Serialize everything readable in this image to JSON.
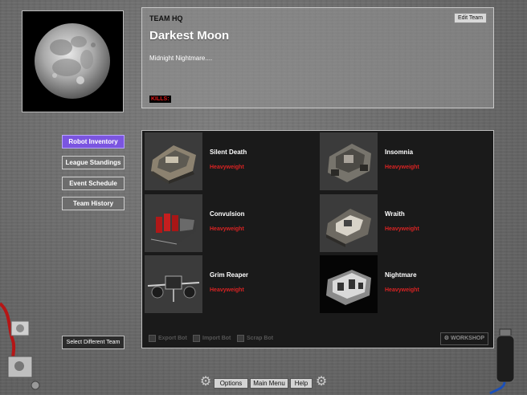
{
  "team": {
    "section_label": "TEAM HQ",
    "name": "Darkest Moon",
    "motto": "Midnight Nightmare....",
    "kills_label": "KILLS:",
    "edit_label": "Edit Team"
  },
  "nav": {
    "robot_inventory": "Robot Inventory",
    "league_standings": "League Standings",
    "event_schedule": "Event Schedule",
    "team_history": "Team History",
    "select_team": "Select Different Team"
  },
  "robots": [
    {
      "name": "Silent Death",
      "class": "Heavyweight"
    },
    {
      "name": "Insomnia",
      "class": "Heavyweight"
    },
    {
      "name": "Convulsion",
      "class": "Heavyweight"
    },
    {
      "name": "Wraith",
      "class": "Heavyweight"
    },
    {
      "name": "Grim Reaper",
      "class": "Heavyweight"
    },
    {
      "name": "Nightmare",
      "class": "Heavyweight"
    }
  ],
  "inventory_bar": {
    "export": "Export Bot",
    "import": "Import Bot",
    "scrap": "Scrap Bot",
    "workshop": "WORKSHOP"
  },
  "menu": {
    "options": "Options",
    "main_menu": "Main Menu",
    "help": "Help"
  },
  "colors": {
    "accent_nav": "#7b55e0",
    "weight_class": "#d82323",
    "kills": "#e01b1b"
  }
}
